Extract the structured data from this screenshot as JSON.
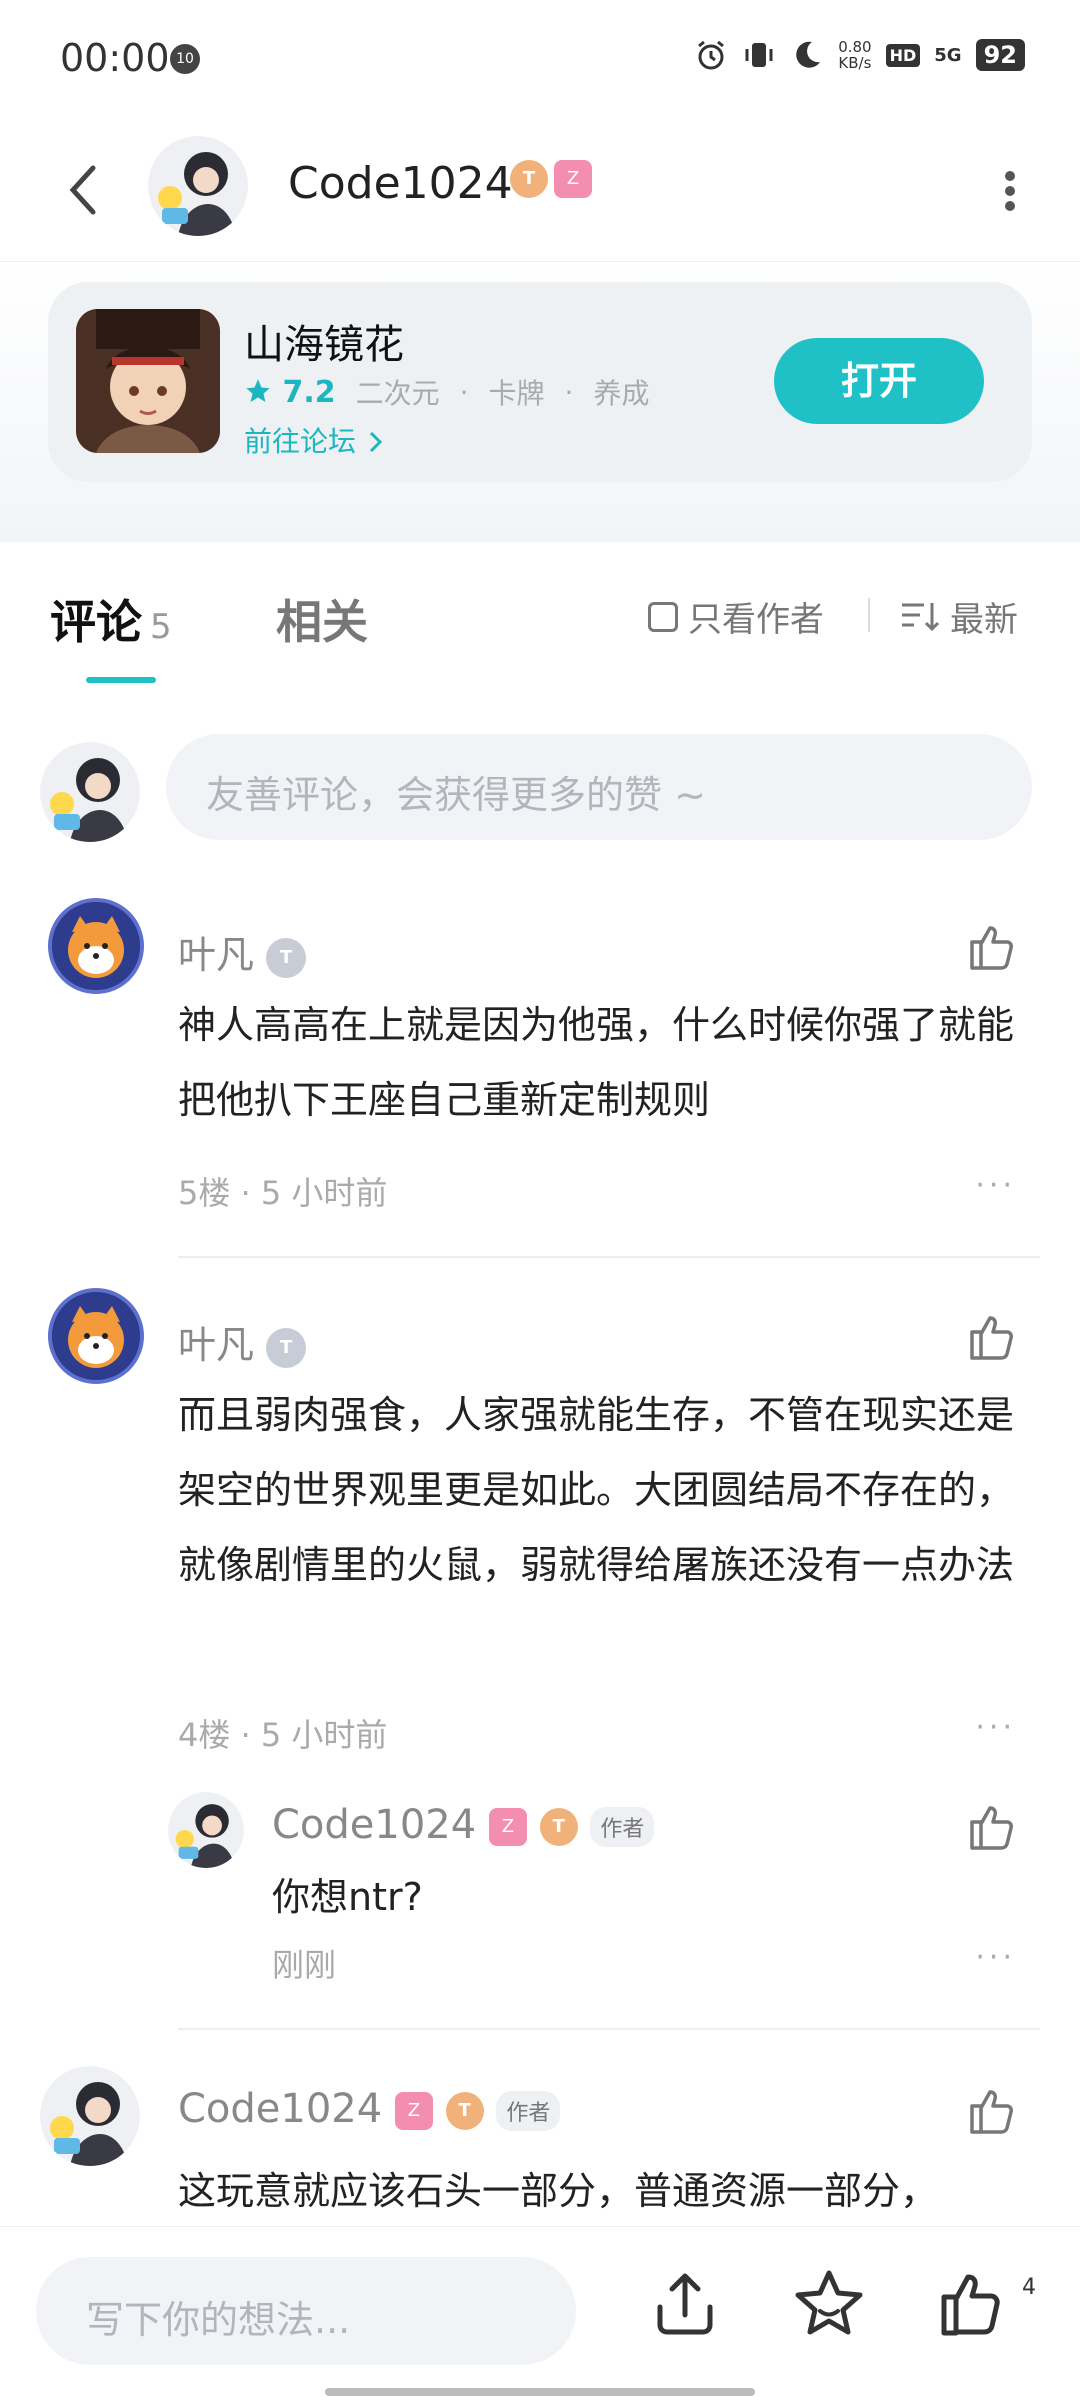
{
  "status_bar": {
    "time": "00:00",
    "notif_badge": "10",
    "net_speed_value": "0.80",
    "net_speed_unit": "KB/s",
    "hd": "HD",
    "signal": "5G",
    "battery": "92"
  },
  "nav": {
    "title": "Code1024",
    "badge_t": "T",
    "badge_s": "Z"
  },
  "game": {
    "name": "山海镜花",
    "rating": "7.2",
    "tags": [
      "二次元",
      "卡牌",
      "养成"
    ],
    "separator": "·",
    "forum_link": "前往论坛",
    "open_label": "打开"
  },
  "tabs": {
    "comments_label": "评论",
    "comments_count": "5",
    "related_label": "相关",
    "only_author_label": "只看作者",
    "sort_label": "最新"
  },
  "comment_input": {
    "placeholder": "友善评论，会获得更多的赞 ~"
  },
  "comments": [
    {
      "author": "叶凡",
      "badge": "T",
      "text": "神人高高在上就是因为他强，什么时候你强了就能把他扒下王座自己重新定制规则",
      "floor": "5楼",
      "time": "5 小时前",
      "more": "···"
    },
    {
      "author": "叶凡",
      "badge": "T",
      "text": "而且弱肉强食，人家强就能生存，不管在现实还是架空的世界观里更是如此。大团圆结局不存在的，就像剧情里的火鼠，弱就得给屠族还没有一点办法",
      "floor": "4楼",
      "time": "5 小时前",
      "more": "···",
      "reply": {
        "author": "Code1024",
        "author_tag": "作者",
        "text": "你想ntr?",
        "time": "刚刚",
        "more": "···"
      }
    },
    {
      "author": "Code1024",
      "author_tag": "作者",
      "text": "这玩意就应该石头一部分，普通资源一部分，"
    }
  ],
  "meta_separator": "·",
  "bottom_bar": {
    "placeholder": "写下你的想法...",
    "like_count": "4"
  }
}
